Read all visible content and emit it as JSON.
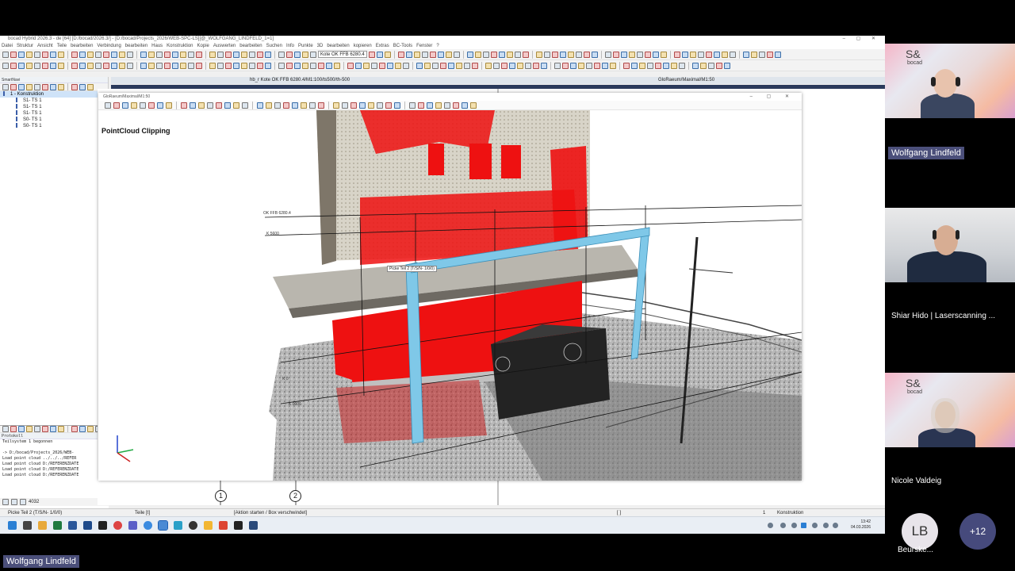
{
  "app": {
    "title": "bocad Hybrid 2026.3 - de [64] [D:/bocad/2026.3/] - [D:/bocad/Projects_2026/WEB-SPC-LS][@_WOLFGANG_LINDFELD_1=1]",
    "menu": [
      "Datei",
      "Struktur",
      "Ansicht",
      "Teile",
      "bearbeiten",
      "Verbindung",
      "bearbeiten",
      "Haus",
      "Konstruktion",
      "Kopie",
      "Auswerten",
      "bearbeiten",
      "Suchen",
      "Info",
      "Punkte",
      "3D",
      "bearbeiten",
      "kopieren",
      "Extras",
      "BC-Tools",
      "Fenster",
      "?"
    ],
    "kote_select": "Kote OK FFB 6280.4"
  },
  "left_panel": {
    "header": "SmartNavi",
    "tree": [
      {
        "label": "1 - Konstruktion",
        "selected": true,
        "level": 0
      },
      {
        "label": "S1- TS 1",
        "selected": false,
        "level": 1
      },
      {
        "label": "S1- TS 1",
        "selected": false,
        "level": 1
      },
      {
        "label": "S1- TS 1",
        "selected": false,
        "level": 1
      },
      {
        "label": "S0- TS 1",
        "selected": false,
        "level": 1
      },
      {
        "label": "S0- TS 1",
        "selected": false,
        "level": 1
      }
    ],
    "protocol_header": "Protokoll",
    "protocol_lines": [
      "Teilsystem 1  begonnen",
      "",
      "-> D:/bocad/Projects_2026/WEB-",
      "Load point cloud ../../../REFER",
      "Load point cloud D:/REFERENZDATE",
      "Load point cloud D:/REFERENZDATE",
      "Load point cloud D:/REFERENZDATE"
    ],
    "footer_value": "4032"
  },
  "view_tabs": {
    "left": "hb_r Kote OK FFB 6280.4/M1:100/ts500/th-500",
    "right": "GloRaeum/Maximal/M1:50"
  },
  "pointcloud_window": {
    "title": "GloRaeum/Maximal/M1:50",
    "label": "PointCloud Clipping",
    "tooltip": "Picke Teil 2 (T/S/N- 1/0/0)",
    "level_labels": [
      "OK FFB 6280.4",
      "K 5600",
      "K 0",
      "K 0000"
    ]
  },
  "drawing": {
    "axes": [
      "1",
      "2"
    ]
  },
  "statusbar": {
    "prompt": "Picke Teil 2 (T/S/N- 1/0/0)",
    "mode": "Teile [t]",
    "action": "[Aktion starten / Box verschwindet]",
    "cursor": "[ ]",
    "ts": "1",
    "system": "Konstruktion"
  },
  "taskbar": {
    "time": "13:42",
    "date": "04.03.2026"
  },
  "participants": [
    {
      "name": "Wolfgang Lindfeld",
      "highlight": true
    },
    {
      "name": "Shiar Hido | Laserscanning ...",
      "highlight": false
    },
    {
      "name": "Nicole Valdeig",
      "highlight": false
    }
  ],
  "company_logo": {
    "line1": "S&",
    "line2": "bocad"
  },
  "overflow": {
    "initials": "LB",
    "name": "Beurske...",
    "more": "+12"
  },
  "presenter_name": "Wolfgang Lindfeld",
  "colors": {
    "accent": "#4b4f7a",
    "pointcloud_red": "#ee1111",
    "beam_blue": "#7fc8e8",
    "dark_bar": "#2b3a5c"
  }
}
